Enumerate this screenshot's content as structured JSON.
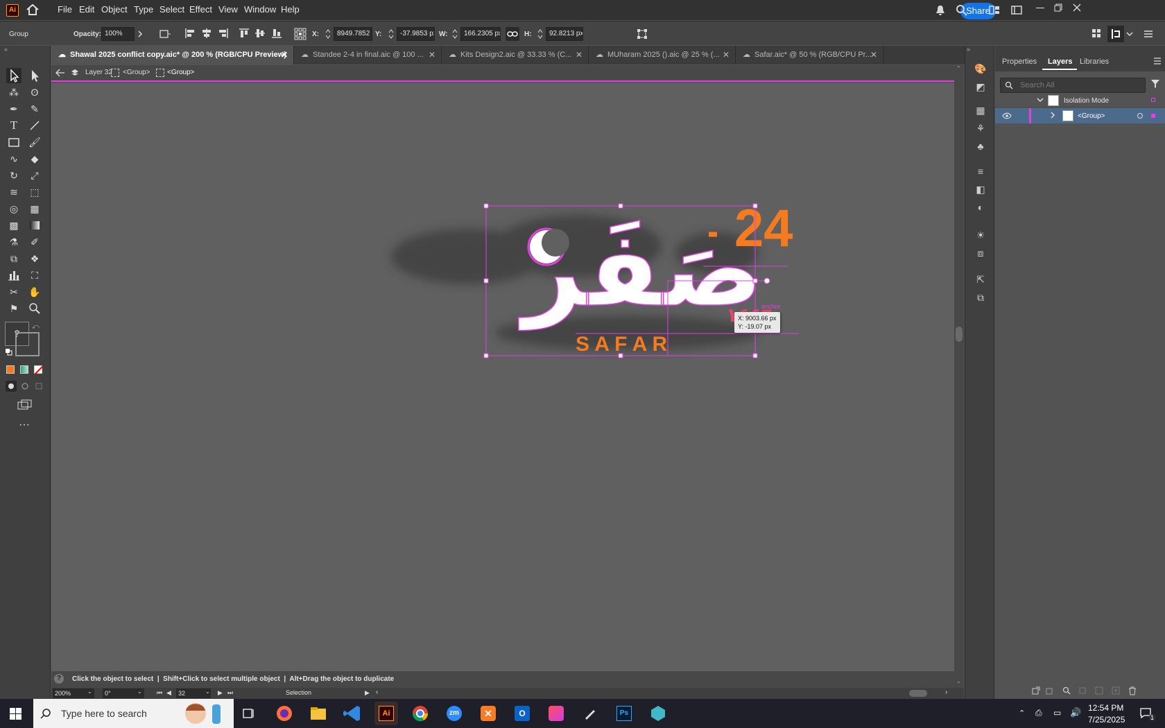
{
  "app": {
    "logo_text": "Ai",
    "accent_color": "#ff9a00"
  },
  "menu": {
    "items": [
      "File",
      "Edit",
      "Object",
      "Type",
      "Select",
      "Effect",
      "View",
      "Window",
      "Help"
    ],
    "share_label": "Share"
  },
  "control": {
    "object_type": "Group",
    "opacity_label": "Opacity:",
    "opacity_value": "100%",
    "x_label": "X:",
    "x_value": "8949.7852 p",
    "y_label": "Y:",
    "y_value": "-37.9853 px",
    "w_label": "W:",
    "w_value": "166.2305 px",
    "h_label": "H:",
    "h_value": "92.8213 px"
  },
  "tabs": [
    {
      "label": "Shawal 2025 conflict copy.aic* @ 200 % (RGB/CPU Preview)",
      "active": true
    },
    {
      "label": "Standee 2-4 in final.aic @ 100 ...",
      "active": false
    },
    {
      "label": "Kits Design2.aic @ 33.33 % (C...",
      "active": false
    },
    {
      "label": "MUharam 2025 ().aic @ 25 % (...",
      "active": false
    },
    {
      "label": "Safar.aic* @ 50 % (RGB/CPU Pr...",
      "active": false
    }
  ],
  "breadcrumb": {
    "layer": "Layer 32",
    "group1": "<Group>",
    "group2": "<Group>"
  },
  "toolbar": {
    "fill_help": "?"
  },
  "artwork": {
    "number": "24",
    "arabic": "صَفَر",
    "english": "S A F A R",
    "year_arabic": "١٤٤٦",
    "anchor_label": "anchor",
    "tooltip_x": "X: 9003.66 px",
    "tooltip_y": "Y: -19.07 px",
    "primary_color": "#f47b20",
    "selection_color": "#e23ee2",
    "year_color": "#e8456a"
  },
  "status": {
    "message": "Click the object to select  |  Shift+Click to select multiple object  |  Alt+Drag the object to duplicate",
    "zoom": "200%",
    "rotation": "0°",
    "artboard": "32",
    "tool": "Selection"
  },
  "panel": {
    "tabs": [
      "Properties",
      "Layers",
      "Libraries"
    ],
    "active_tab": "Layers",
    "search_placeholder": "Search All",
    "isolation_label": "Isolation Mode",
    "group_label": "<Group>"
  },
  "taskbar": {
    "search_placeholder": "Type here to search",
    "time": "12:54 PM",
    "date": "7/25/2025",
    "notification_count": "1",
    "apps": [
      "firefox-icon",
      "file-explorer-icon",
      "vscode-icon",
      "illustrator-icon",
      "chrome-icon",
      "zoom-icon",
      "xampp-icon",
      "outlook-icon",
      "creative-cloud-icon",
      "pen-icon",
      "photoshop-icon",
      "app-icon"
    ]
  }
}
